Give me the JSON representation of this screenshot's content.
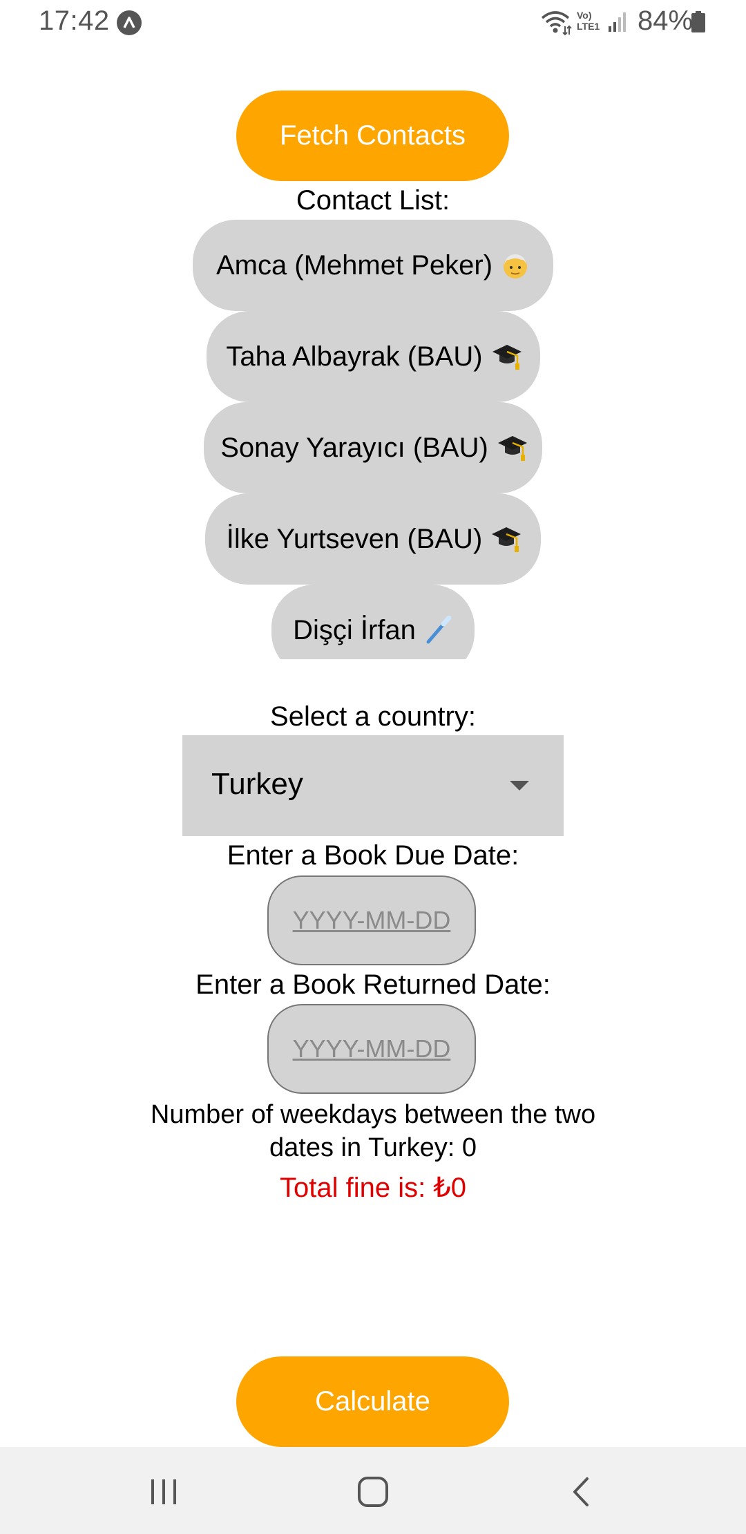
{
  "status_bar": {
    "time": "17:42",
    "battery_percent": "84%",
    "network_label_top": "Vo)",
    "network_label_bottom": "LTE1"
  },
  "fetch_button": {
    "label": "Fetch Contacts"
  },
  "contact_list": {
    "heading": "Contact List:",
    "contacts": [
      {
        "name": "Amca (Mehmet Peker)",
        "icon": "old-man-icon"
      },
      {
        "name": "Taha Albayrak (BAU)",
        "icon": "graduation-cap-icon"
      },
      {
        "name": "Sonay Yarayıcı (BAU)",
        "icon": "graduation-cap-icon"
      },
      {
        "name": "İlke Yurtseven (BAU)",
        "icon": "graduation-cap-icon"
      },
      {
        "name": "Dişçi İrfan",
        "icon": "toothbrush-icon"
      }
    ]
  },
  "country": {
    "label": "Select a country:",
    "selected": "Turkey"
  },
  "due_date": {
    "label": "Enter a Book Due Date:",
    "placeholder": "YYYY-MM-DD",
    "value": ""
  },
  "returned_date": {
    "label": "Enter a Book Returned Date:",
    "placeholder": "YYYY-MM-DD",
    "value": ""
  },
  "result": {
    "weekdays_line1": "Number of weekdays between the two",
    "weekdays_line2": "dates in Turkey: 0",
    "fine": "Total fine is: ₺0"
  },
  "calculate_button": {
    "label": "Calculate"
  },
  "colors": {
    "accent": "#FFA500",
    "pill": "#D3D3D3",
    "fine": "#E10000"
  }
}
